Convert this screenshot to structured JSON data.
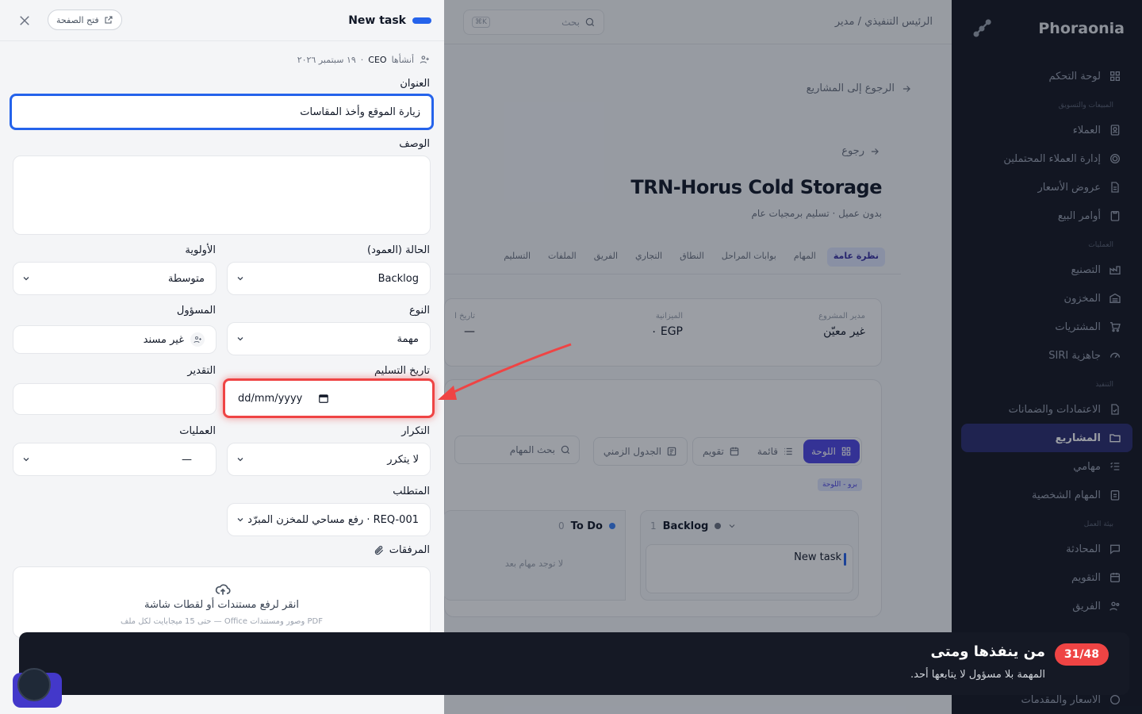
{
  "sidebar": {
    "brand": "Phoraonia",
    "items": [
      {
        "label": "لوحة التحكم",
        "icon": "grid-icon"
      },
      {
        "section": "المبيعات والتسويق"
      },
      {
        "label": "العملاء",
        "icon": "contacts-icon"
      },
      {
        "label": "إدارة العملاء المحتملين",
        "icon": "target-icon"
      },
      {
        "label": "عروض الأسعار",
        "icon": "document-icon"
      },
      {
        "label": "أوامر البيع",
        "icon": "clipboard-icon"
      },
      {
        "section": "العمليات"
      },
      {
        "label": "التصنيع",
        "icon": "factory-icon"
      },
      {
        "label": "المخزون",
        "icon": "warehouse-icon"
      },
      {
        "label": "المشتريات",
        "icon": "cart-icon"
      },
      {
        "label": "جاهزية SIRI",
        "icon": "gauge-icon"
      },
      {
        "section": "التنفيذ"
      },
      {
        "label": "الاعتمادات والضمانات",
        "icon": "file-check-icon"
      },
      {
        "label": "المشاريع",
        "icon": "folder-icon",
        "active": true
      },
      {
        "label": "مهامي",
        "icon": "list-check-icon"
      },
      {
        "label": "المهام الشخصية",
        "icon": "clipboard-list-icon"
      },
      {
        "section": "بيئة العمل"
      },
      {
        "label": "المحادثة",
        "icon": "chat-icon"
      },
      {
        "label": "التقويم",
        "icon": "calendar-icon"
      },
      {
        "label": "الفريق",
        "icon": "users-icon"
      }
    ],
    "footer_item": "الأسعار والمقدمات"
  },
  "main": {
    "breadcrumb": "الرئيس التنفيذي / مدير",
    "search_placeholder": "بحث",
    "search_kbd": "K⌘",
    "back_to_projects": "الرجوع إلى المشاريع",
    "back": "رجوع",
    "project_title": "TRN-Horus Cold Storage",
    "project_subtitle": "بدون عميل · تسليم برمجيات عام",
    "tabs": [
      "نظرة عامة",
      "المهام",
      "بوابات المراحل",
      "النطاق",
      "التجاري",
      "الفريق",
      "الملفات",
      "التسليم"
    ],
    "info": {
      "manager_label": "مدير المشروع",
      "manager_value": "غير معيّن",
      "budget_label": "الميزانية",
      "budget_value": "EGP ٠",
      "delivery_label": "تاريخ ا",
      "delivery_value": "—"
    },
    "views": [
      "اللوحة",
      "قائمة",
      "تقويم",
      "الجدول الزمني"
    ],
    "task_search": "بحث المهام",
    "pro_badge": "برو - اللوحة",
    "columns": [
      {
        "name": "Backlog",
        "count": "1",
        "color": "#6b7280",
        "card": "New task"
      },
      {
        "name": "To Do",
        "count": "0",
        "color": "#3b82f6",
        "empty": "لا توجد مهام بعد"
      }
    ]
  },
  "drawer": {
    "title": "New task",
    "open_page": "فتح الصفحة",
    "meta_created": "أنشأها",
    "meta_by": "CEO",
    "meta_date": "١٩ سبتمبر ٢٠٢٦",
    "title_label": "العنوان",
    "title_value": "زيارة الموقع وأخذ المقاسات",
    "desc_label": "الوصف",
    "status_label": "الحالة (العمود)",
    "status_value": "Backlog",
    "priority_label": "الأولوية",
    "priority_value": "متوسطة",
    "type_label": "النوع",
    "type_value": "مهمة",
    "assignee_label": "المسؤول",
    "assignee_value": "غير مسند",
    "due_label": "تاريخ التسليم",
    "due_placeholder": "dd/mm/yyyy",
    "estimate_label": "التقدير",
    "repeat_label": "التكرار",
    "repeat_value": "لا يتكرر",
    "ops_label": "العمليات",
    "ops_value": "—",
    "req_label": "المتطلب",
    "req_value": "REQ-001 · رفع مساحي للمخزن المبرّد",
    "attach_label": "المرفقات",
    "upload_text": "انقر لرفع مستندات أو لقطات شاشة",
    "upload_hint": "PDF وصور ومستندات Office — حتى 15 ميجابايت لكل ملف"
  },
  "tour": {
    "step": "31/48",
    "title": "من ينفذها ومتى",
    "desc": "المهمة بلا مسؤول لا يتابعها أحد."
  }
}
